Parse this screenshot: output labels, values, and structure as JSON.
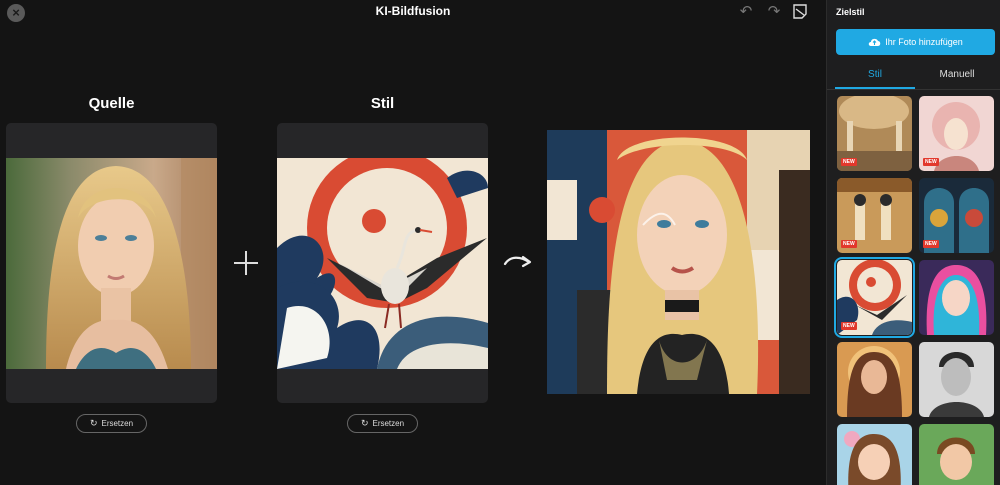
{
  "header": {
    "title": "KI-Bildfusion",
    "close_icon": "close-icon",
    "undo_icon": "undo-icon",
    "redo_icon": "redo-icon",
    "note_icon": "note-icon"
  },
  "source": {
    "title": "Quelle",
    "replace_label": "Ersetzen"
  },
  "style": {
    "title": "Stil",
    "replace_label": "Ersetzen"
  },
  "panel": {
    "title": "Zielstil",
    "upload_label": "Ihr Foto hinzufügen",
    "tabs": [
      {
        "label": "Stil",
        "active": true
      },
      {
        "label": "Manuell",
        "active": false
      }
    ],
    "thumbnails": [
      {
        "name": "palace-interior",
        "badge": "NEW"
      },
      {
        "name": "art-nouveau-portrait",
        "badge": "NEW"
      },
      {
        "name": "egyptian-mural",
        "badge": "NEW"
      },
      {
        "name": "stained-glass",
        "badge": "NEW"
      },
      {
        "name": "japanese-wave-crane",
        "badge": "NEW",
        "selected": true
      },
      {
        "name": "rainbow-anime-girl"
      },
      {
        "name": "golden-goddess"
      },
      {
        "name": "bw-sketch-man"
      },
      {
        "name": "cartoon-girl"
      },
      {
        "name": "cartoon-boy"
      }
    ]
  },
  "colors": {
    "accent": "#20a9e3",
    "badge": "#e2382c",
    "background": "#141414",
    "panel": "#1e1e1f"
  }
}
